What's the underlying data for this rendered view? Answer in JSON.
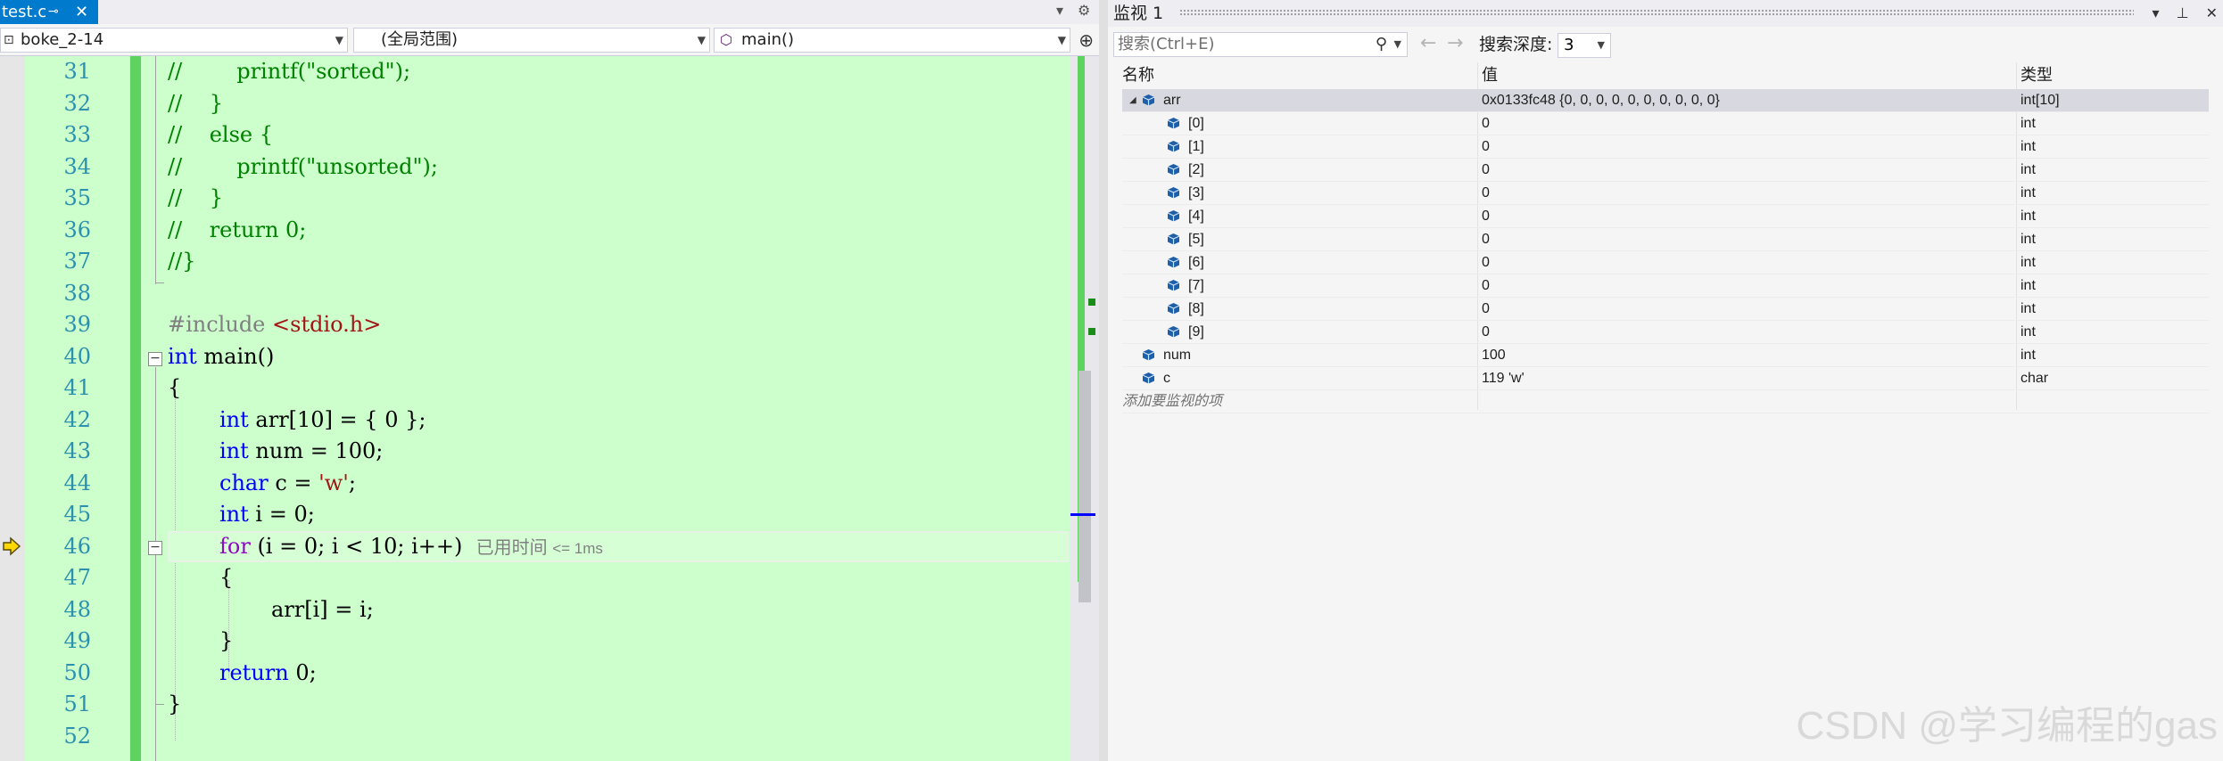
{
  "editor": {
    "tab": {
      "filename": "test.c",
      "pin_icon": "pin-icon",
      "close_icon": "close-icon"
    },
    "tabbar_right": {
      "dropdown_icon": "chevron-down-icon",
      "settings_icon": "gear-icon"
    },
    "nav": {
      "project": "boke_2-14",
      "scope": "(全局范围)",
      "function": "main()",
      "function_icon": "cube-icon",
      "split_icon": "split-icon"
    },
    "line_numbers": [
      "31",
      "32",
      "33",
      "34",
      "35",
      "36",
      "37",
      "38",
      "39",
      "40",
      "41",
      "42",
      "43",
      "44",
      "45",
      "46",
      "47",
      "48",
      "49",
      "50",
      "51",
      "52"
    ],
    "code": {
      "l31": {
        "comment": "//        printf(\"sorted\");"
      },
      "l32": {
        "comment": "//    }"
      },
      "l33": {
        "comment": "//    else {"
      },
      "l34": {
        "comment": "//        printf(\"unsorted\");"
      },
      "l35": {
        "comment": "//    }"
      },
      "l36": {
        "comment": "//    return 0;"
      },
      "l37": {
        "comment": "//}"
      },
      "l39": {
        "directive": "#include ",
        "header": "<stdio.h>"
      },
      "l40": {
        "kw": "int",
        "rest": " main()"
      },
      "l41": {
        "text": "{"
      },
      "l42": {
        "kw": "int",
        "rest": " arr[10] = { 0 };"
      },
      "l43": {
        "kw": "int",
        "rest": " num = 100;"
      },
      "l44": {
        "kw": "char",
        "mid": " c = ",
        "str": "'w'",
        "end": ";"
      },
      "l45": {
        "kw": "int",
        "rest": " i = 0;"
      },
      "l46": {
        "kw": "for",
        "rest": " (i = 0; i < 10; i++)",
        "hint_label": "已用时间",
        "hint_value": "<= 1ms"
      },
      "l47": {
        "text": "{"
      },
      "l48": {
        "text": "arr[i] = i;"
      },
      "l49": {
        "text": "}"
      },
      "l50": {
        "kw": "return",
        "rest": " 0;"
      },
      "l51": {
        "text": "}"
      }
    },
    "current_line": "46",
    "exec_icon": "execution-arrow-icon"
  },
  "watch": {
    "title": "监视 1",
    "title_buttons": {
      "dropdown_icon": "chevron-down-icon",
      "pin_icon": "pin-icon",
      "close_icon": "close-icon"
    },
    "search": {
      "placeholder": "搜索(Ctrl+E)",
      "icon": "search-icon"
    },
    "back_icon": "arrow-left-icon",
    "forward_icon": "arrow-right-icon",
    "depth_label": "搜索深度:",
    "depth_value": "3",
    "headers": {
      "name": "名称",
      "value": "值",
      "type": "类型"
    },
    "rows": [
      {
        "name": "arr",
        "value": "0x0133fc48 {0, 0, 0, 0, 0, 0, 0, 0, 0, 0}",
        "type": "int[10]"
      },
      {
        "name": "[0]",
        "value": "0",
        "type": "int"
      },
      {
        "name": "[1]",
        "value": "0",
        "type": "int"
      },
      {
        "name": "[2]",
        "value": "0",
        "type": "int"
      },
      {
        "name": "[3]",
        "value": "0",
        "type": "int"
      },
      {
        "name": "[4]",
        "value": "0",
        "type": "int"
      },
      {
        "name": "[5]",
        "value": "0",
        "type": "int"
      },
      {
        "name": "[6]",
        "value": "0",
        "type": "int"
      },
      {
        "name": "[7]",
        "value": "0",
        "type": "int"
      },
      {
        "name": "[8]",
        "value": "0",
        "type": "int"
      },
      {
        "name": "[9]",
        "value": "0",
        "type": "int"
      },
      {
        "name": "num",
        "value": "100",
        "type": "int"
      },
      {
        "name": "c",
        "value": "119 'w'",
        "type": "char"
      }
    ],
    "add_item": "添加要监视的项",
    "expander_icon": "collapse-triangle-icon",
    "variable_icon": "variable-cube-icon"
  },
  "watermark": "CSDN @学习编程的gas",
  "colors": {
    "accent": "#007acc",
    "code_background": "#ccffcc",
    "change_bar": "#5fd35f",
    "comment": "#008000",
    "keyword": "#0000ff",
    "control_keyword": "#8f08c4",
    "string": "#a31515",
    "line_number": "#2b91af"
  }
}
